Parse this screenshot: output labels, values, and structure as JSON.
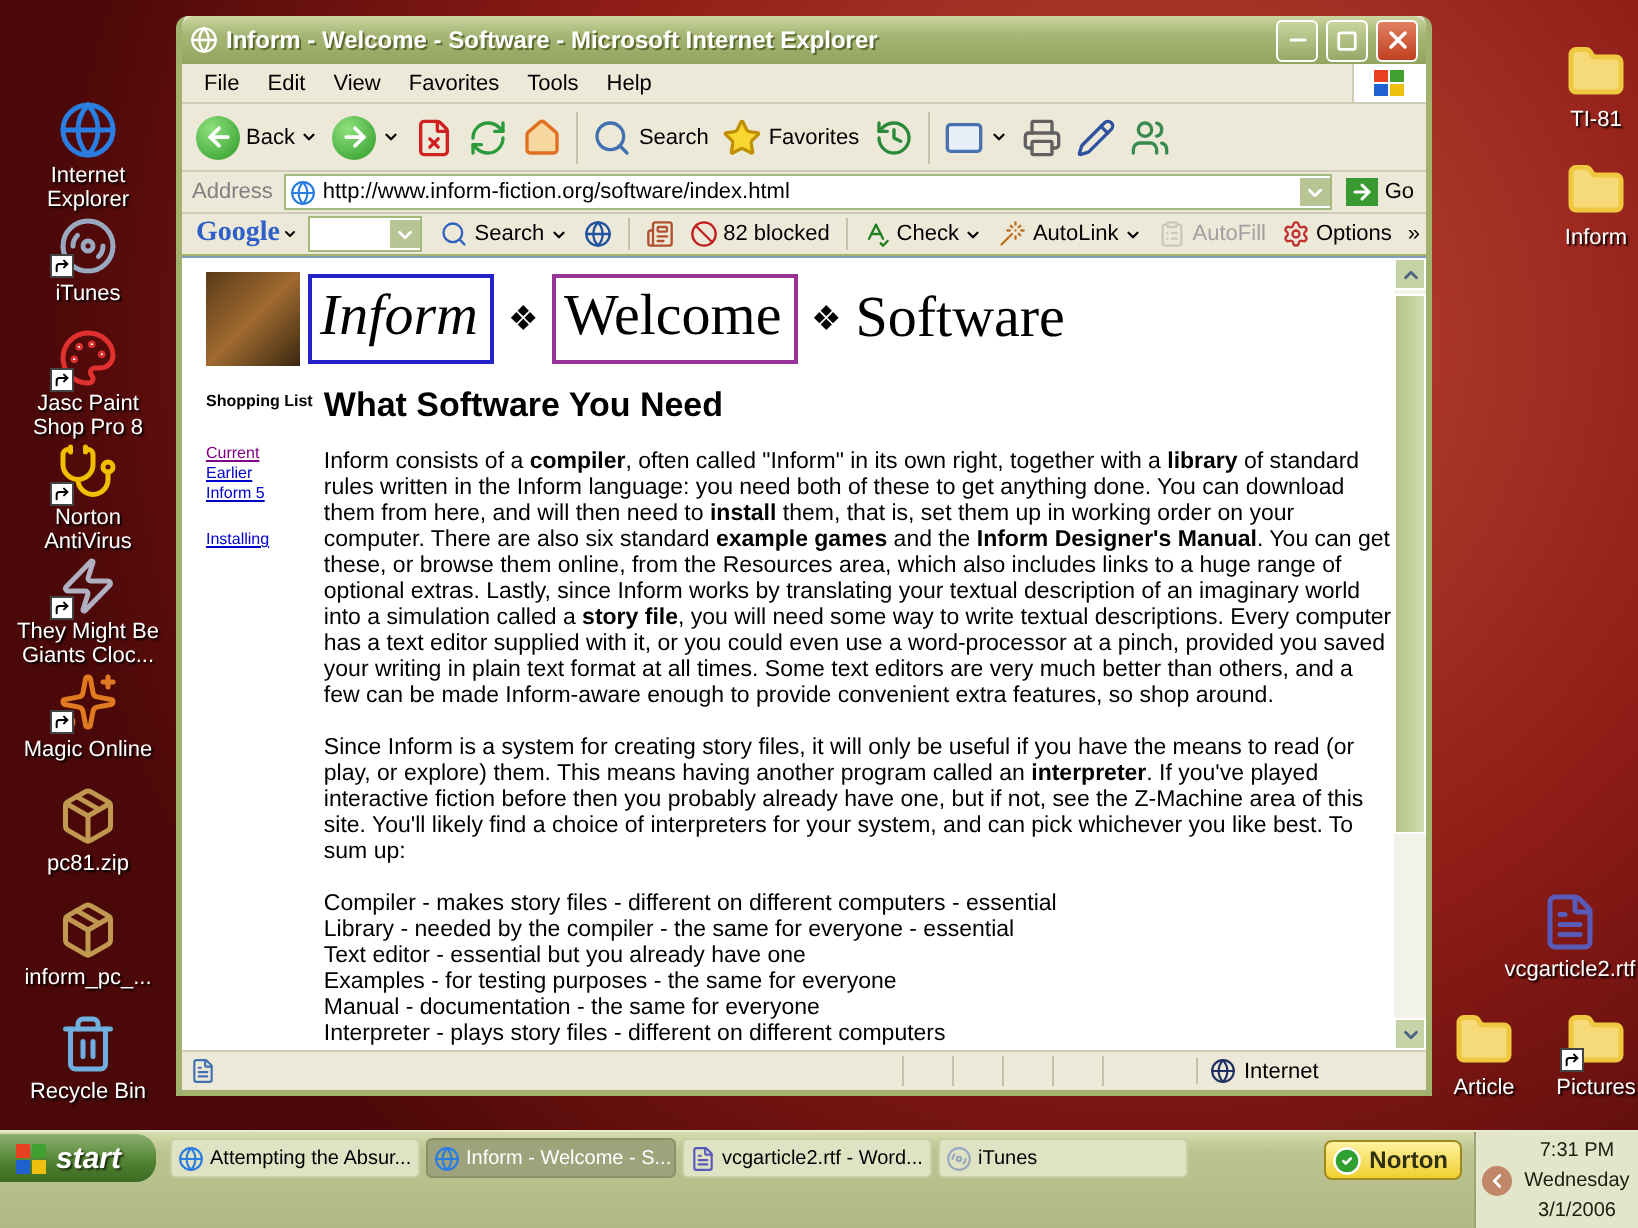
{
  "desktop": {
    "left_icons": [
      {
        "label": "Internet Explorer",
        "kind": "browser",
        "shortcut": false
      },
      {
        "label": "iTunes",
        "kind": "music",
        "shortcut": true
      },
      {
        "label": "Jasc Paint Shop Pro 8",
        "kind": "paint",
        "shortcut": true
      },
      {
        "label": "Norton AntiVirus",
        "kind": "health",
        "shortcut": true
      },
      {
        "label": "They Might Be Giants Cloc...",
        "kind": "flash",
        "shortcut": true
      },
      {
        "label": "Magic Online",
        "kind": "game",
        "shortcut": true
      },
      {
        "label": "pc81.zip",
        "kind": "zip",
        "shortcut": false
      },
      {
        "label": "inform_pc_...",
        "kind": "zip",
        "shortcut": false
      },
      {
        "label": "Recycle Bin",
        "kind": "recycle",
        "shortcut": false
      }
    ],
    "right_top": [
      {
        "label": "TI-81",
        "kind": "folder",
        "shortcut": false
      },
      {
        "label": "Inform",
        "kind": "folder",
        "shortcut": false
      }
    ],
    "right_middle": [
      {
        "label": "vcgarticle2.rtf",
        "kind": "document",
        "shortcut": false
      }
    ],
    "right_bottom": [
      {
        "label": "Article",
        "kind": "folder",
        "shortcut": false
      },
      {
        "label": "Pictures",
        "kind": "folder",
        "shortcut": true
      }
    ]
  },
  "window": {
    "title": "Inform - Welcome - Software - Microsoft Internet Explorer",
    "menu": [
      "File",
      "Edit",
      "View",
      "Favorites",
      "Tools",
      "Help"
    ],
    "toolbar": [
      {
        "kind": "back",
        "label": "Back",
        "dropdown": true
      },
      {
        "kind": "forward",
        "dropdown": true
      },
      {
        "kind": "stop",
        "dropdown": false
      },
      {
        "kind": "refresh",
        "dropdown": false
      },
      {
        "kind": "home",
        "dropdown": false
      },
      {
        "kind": "separator"
      },
      {
        "kind": "search",
        "label": "Search",
        "dropdown": false
      },
      {
        "kind": "favorites",
        "label": "Favorites",
        "dropdown": false
      },
      {
        "kind": "history",
        "dropdown": false
      },
      {
        "kind": "separator"
      },
      {
        "kind": "mail",
        "dropdown": true
      },
      {
        "kind": "print",
        "dropdown": false
      },
      {
        "kind": "edit",
        "dropdown": false
      },
      {
        "kind": "messenger",
        "dropdown": false
      }
    ],
    "address": {
      "label": "Address",
      "value": "http://www.inform-fiction.org/software/index.html",
      "go": "Go"
    },
    "google_bar": {
      "logo": "Google",
      "items": [
        {
          "kind": "search",
          "label": "Search",
          "dropdown": true,
          "disabled": false
        },
        {
          "kind": "globe",
          "dropdown": false,
          "disabled": false
        },
        {
          "kind": "separator"
        },
        {
          "kind": "news",
          "dropdown": false,
          "disabled": false
        },
        {
          "kind": "blocker",
          "label": "82 blocked",
          "dropdown": false,
          "disabled": false
        },
        {
          "kind": "separator"
        },
        {
          "kind": "spell",
          "label": "Check",
          "dropdown": true,
          "disabled": false
        },
        {
          "kind": "wand",
          "label": "AutoLink",
          "dropdown": true,
          "disabled": false
        },
        {
          "kind": "autofill",
          "label": "AutoFill",
          "dropdown": false,
          "disabled": true
        },
        {
          "kind": "options",
          "label": "Options",
          "dropdown": false,
          "disabled": false
        },
        {
          "kind": "more",
          "label": "»",
          "dropdown": false,
          "disabled": false
        }
      ]
    },
    "page": {
      "banner": [
        {
          "kind": "image"
        },
        {
          "kind": "boxed",
          "text": "Inform",
          "color": "#2323c8",
          "italic": true
        },
        {
          "kind": "ornament",
          "text": "❖"
        },
        {
          "kind": "boxed",
          "text": "Welcome",
          "color": "#993399",
          "italic": false
        },
        {
          "kind": "ornament",
          "text": "❖"
        },
        {
          "kind": "plain",
          "text": "Software"
        }
      ],
      "sidebar": {
        "title": "Shopping List",
        "link_groups": [
          [
            {
              "label": "Current",
              "visited": true
            },
            {
              "label": "Earlier",
              "visited": false
            },
            {
              "label": "Inform 5",
              "visited": false
            }
          ],
          [
            {
              "label": "Installing",
              "visited": false
            }
          ]
        ]
      },
      "heading": "What Software You Need",
      "paragraphs": [
        "Inform consists of a **compiler**, often called \"Inform\" in its own right, together with a **library** of standard rules written in the Inform language: you need both of these to get anything done. You can download them from here, and will then need to **install** them, that is, set them up in working order on your computer. There are also six standard **example games** and the **Inform Designer's Manual**. You can get these, or browse them online, from the Resources area, which also includes links to a huge range of optional extras. Lastly, since Inform works by translating your textual description of an imaginary world into a simulation called a **story file**, you will need some way to write textual descriptions. Every computer has a text editor supplied with it, or you could even use a word-processor at a pinch, provided you saved your writing in plain text format at all times. Some text editors are very much better than others, and a few can be made Inform-aware enough to provide convenient extra features, so shop around.",
        "Since Inform is a system for creating story files, it will only be useful if you have the means to read (or play, or explore) them. This means having another program called an **interpreter**. If you've played interactive fiction before then you probably already have one, but if not, see the Z-Machine area of this site. You'll likely find a choice of interpreters for your system, and can pick whichever you like best. To sum up:"
      ],
      "summary": [
        "Compiler - makes story files - different on different computers - essential",
        "Library - needed by the compiler - the same for everyone - essential",
        "Text editor - essential but you already have one",
        "Examples - for testing purposes - the same for everyone",
        "Manual - documentation - the same for everyone",
        "Interpreter - plays story files - different on different computers"
      ]
    },
    "status_bar": {
      "zone": "Internet"
    }
  },
  "taskbar": {
    "start": "start",
    "tasks": [
      {
        "label": "Attempting the Absur...",
        "kind": "browser",
        "selected": false
      },
      {
        "label": "Inform - Welcome - S...",
        "kind": "browser",
        "selected": true
      },
      {
        "label": "vcgarticle2.rtf - Word...",
        "kind": "document",
        "selected": false
      },
      {
        "label": "iTunes",
        "kind": "music",
        "selected": false
      }
    ],
    "tray_app": "Norton",
    "clock": {
      "time": "7:31 PM",
      "day": "Wednesday",
      "date": "3/1/2006"
    }
  }
}
